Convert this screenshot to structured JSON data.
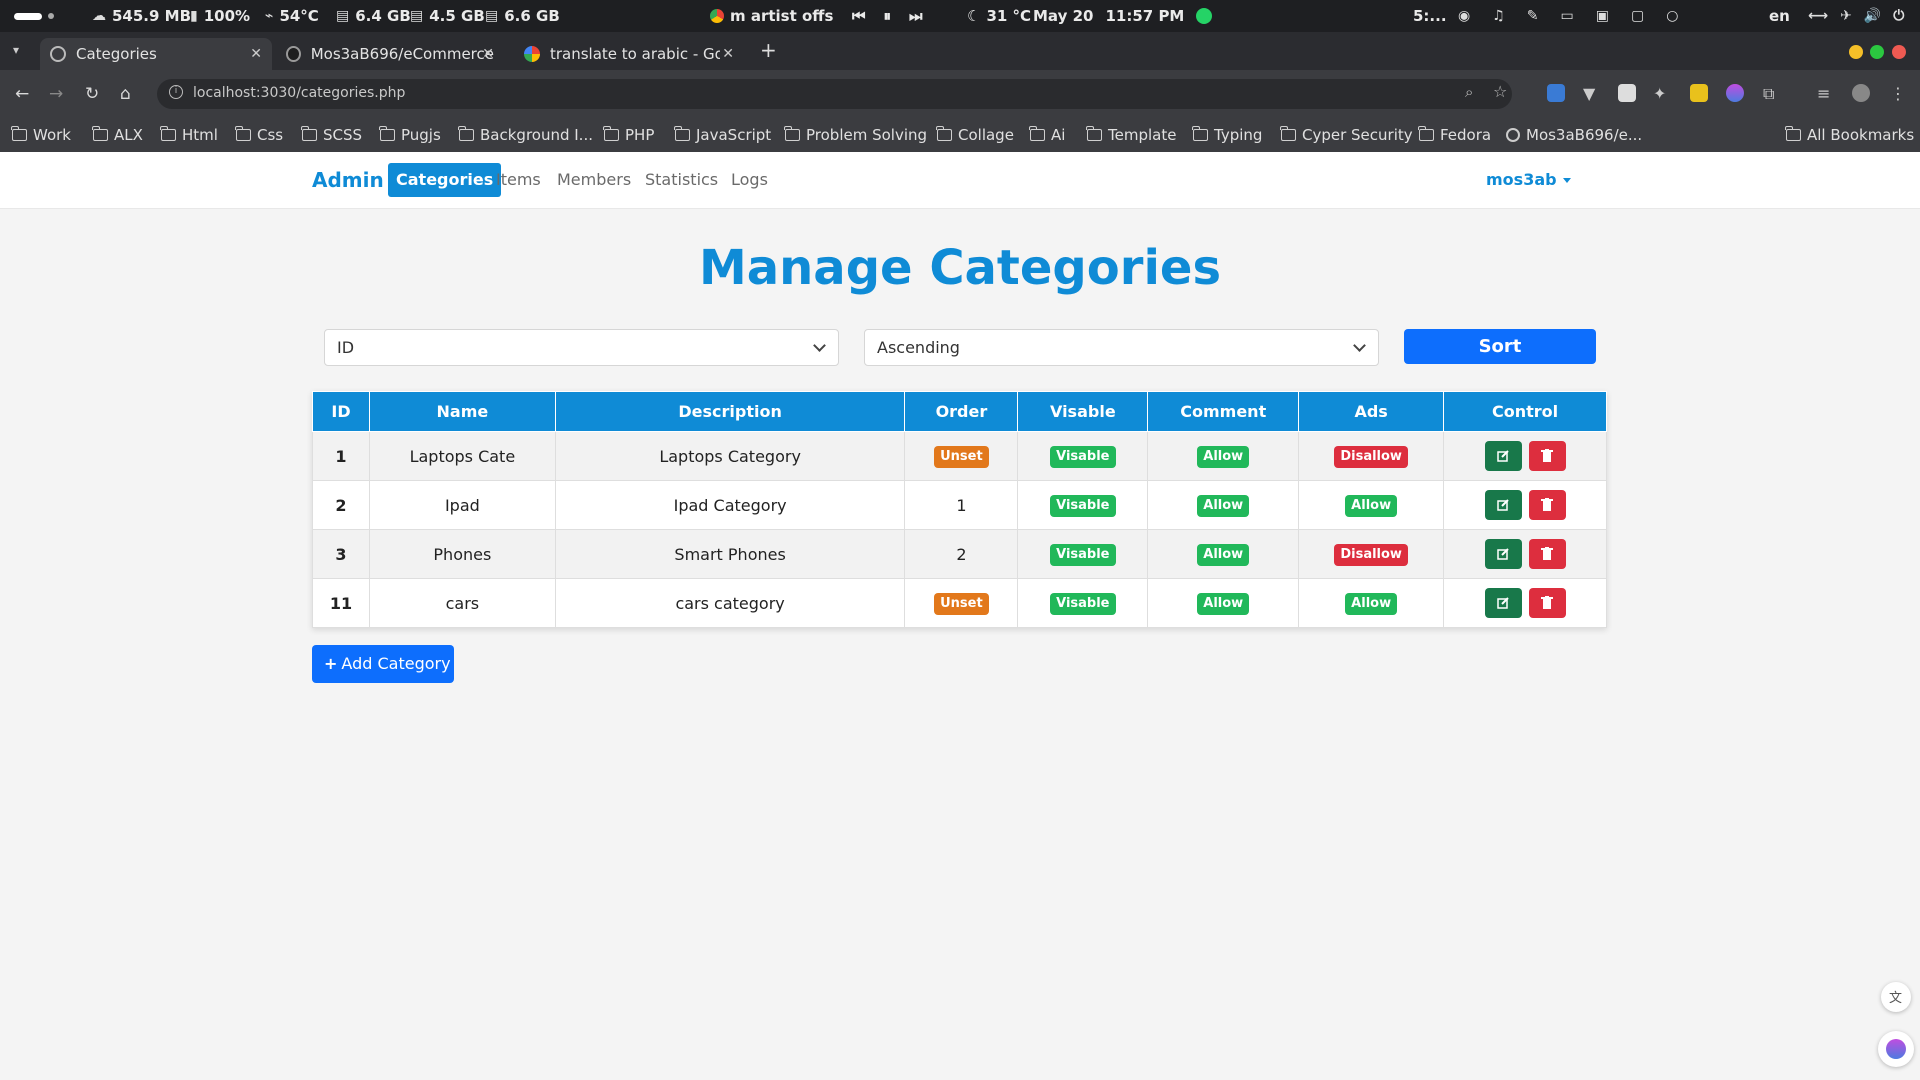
{
  "system_bar": {
    "network": "545.9 MB",
    "battery": "100%",
    "temperature": "54°C",
    "mem1": "6.4 GB",
    "mem2": "4.5 GB",
    "mem3": "6.6 GB",
    "media_title": "m artist offscre",
    "weather": "31 °C",
    "date": "May 20",
    "time": "11:57 PM",
    "workspace": "5:...",
    "language": "en"
  },
  "browser": {
    "tabs": [
      {
        "title": "Categories",
        "active": true
      },
      {
        "title": "Mos3aB696/eCommerce",
        "active": false
      },
      {
        "title": "translate to arabic - Goog",
        "active": false
      }
    ],
    "url": "localhost:3030/categories.php",
    "bookmarks": [
      "Work",
      "ALX",
      "Html",
      "Css",
      "SCSS",
      "Pugjs",
      "Background I...",
      "PHP",
      "JavaScript",
      "Problem Solving",
      "Collage",
      "Ai",
      "Template",
      "Typing",
      "Cyper Security",
      "Fedora",
      "Mos3aB696/e...",
      "All Bookmarks"
    ],
    "accent": "#0f8bd6"
  },
  "navbar": {
    "brand": "Admin",
    "links": [
      "Categories",
      "Items",
      "Members",
      "Statistics",
      "Logs"
    ],
    "user": "mos3ab"
  },
  "page": {
    "title": "Manage Categories",
    "sort_field": "ID",
    "sort_order": "Ascending",
    "sort_button": "Sort",
    "add_button": "Add Category"
  },
  "table": {
    "headers": [
      "ID",
      "Name",
      "Description",
      "Order",
      "Visable",
      "Comment",
      "Ads",
      "Control"
    ],
    "rows": [
      {
        "id": "1",
        "name": "Laptops Cate",
        "description": "Laptops Category",
        "order": "Unset",
        "visible": "Visable",
        "comment": "Allow",
        "ads": "Disallow"
      },
      {
        "id": "2",
        "name": "Ipad",
        "description": "Ipad Category",
        "order": "1",
        "visible": "Visable",
        "comment": "Allow",
        "ads": "Allow"
      },
      {
        "id": "3",
        "name": "Phones",
        "description": "Smart Phones",
        "order": "2",
        "visible": "Visable",
        "comment": "Allow",
        "ads": "Disallow"
      },
      {
        "id": "11",
        "name": "cars",
        "description": "cars category",
        "order": "Unset",
        "visible": "Visable",
        "comment": "Allow",
        "ads": "Allow"
      }
    ]
  }
}
